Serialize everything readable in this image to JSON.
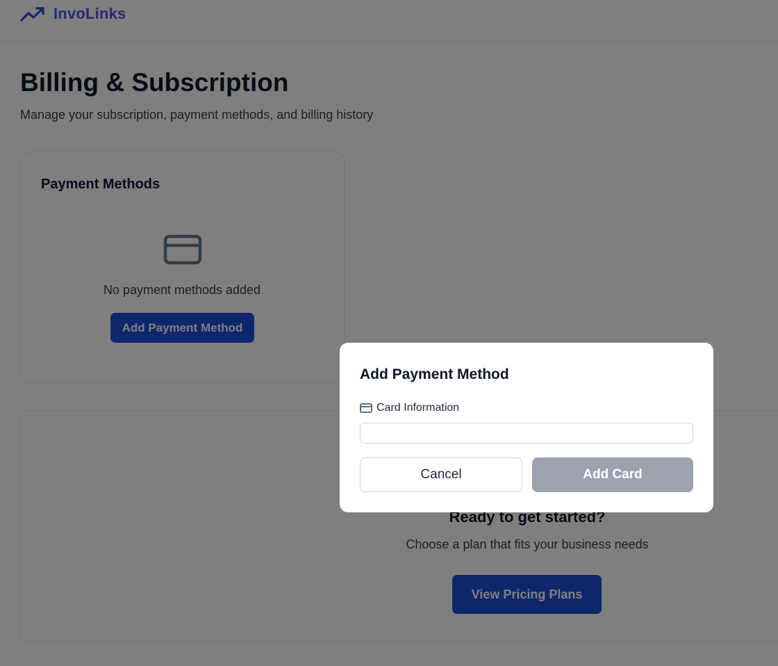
{
  "header": {
    "brand_name": "InvoLinks",
    "brand_icon": "trending-up-icon",
    "brand_gradient": [
      "#2563eb",
      "#7c3aed"
    ]
  },
  "page": {
    "title": "Billing & Subscription",
    "subtitle": "Manage your subscription, payment methods, and billing history"
  },
  "payment_methods": {
    "title": "Payment Methods",
    "empty_icon": "credit-card-icon",
    "empty_text": "No payment methods added",
    "add_button_label": "Add Payment Method"
  },
  "pricing": {
    "title": "Ready to get started?",
    "subtitle": "Choose a plan that fits your business needs",
    "button_label": "View Pricing Plans"
  },
  "modal": {
    "title": "Add Payment Method",
    "field_icon": "credit-card-icon",
    "field_label": "Card Information",
    "card_input_value": "",
    "cancel_label": "Cancel",
    "submit_label": "Add Card",
    "submit_disabled": true
  },
  "colors": {
    "primary": "#1d4ed8",
    "disabled": "#9ca3af",
    "overlay": "rgba(0,0,0,0.5)"
  }
}
